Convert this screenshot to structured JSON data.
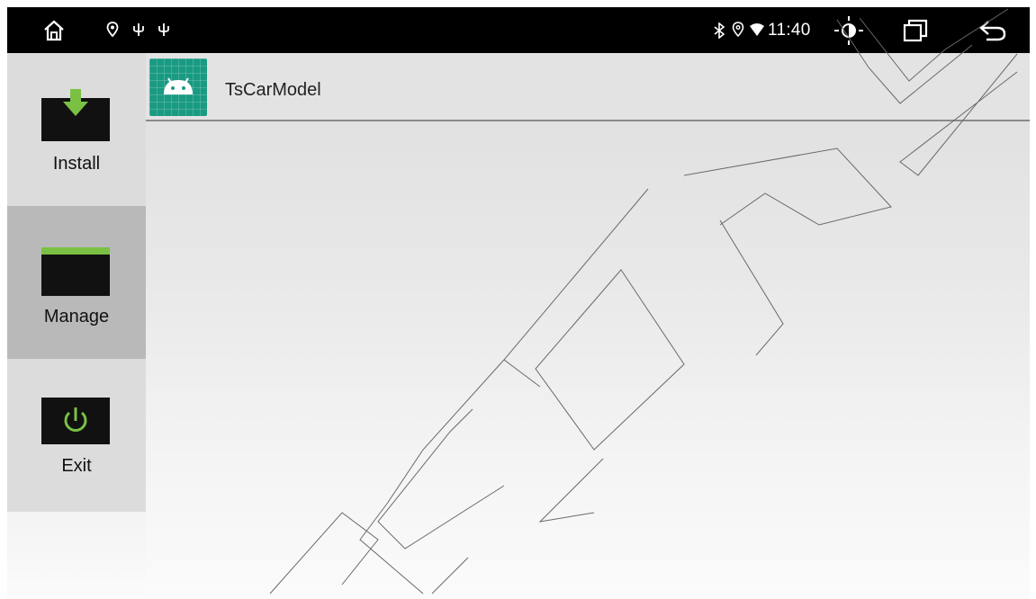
{
  "status_bar": {
    "time": "11:40",
    "left_icons": [
      "home-icon",
      "location-pin-icon",
      "usb-icon",
      "usb-icon"
    ],
    "right_icons": [
      "bluetooth-icon",
      "location-icon",
      "wifi-icon"
    ],
    "controls": [
      "brightness-icon",
      "recent-apps-icon",
      "back-icon"
    ]
  },
  "sidebar": {
    "items": [
      {
        "label": "Install",
        "icon": "download-arrow-icon",
        "active": false
      },
      {
        "label": "Manage",
        "icon": "folder-icon",
        "active": true
      },
      {
        "label": "Exit",
        "icon": "power-icon",
        "active": false
      }
    ]
  },
  "app_list": {
    "items": [
      {
        "name": "TsCarModel",
        "icon": "android-app-icon"
      }
    ]
  },
  "colors": {
    "status_bar_bg": "#000000",
    "sidebar_bg": "#dcdcdc",
    "sidebar_active_bg": "#b9b9b9",
    "accent_green": "#7ac143",
    "app_icon_bg": "#1a9a82"
  }
}
